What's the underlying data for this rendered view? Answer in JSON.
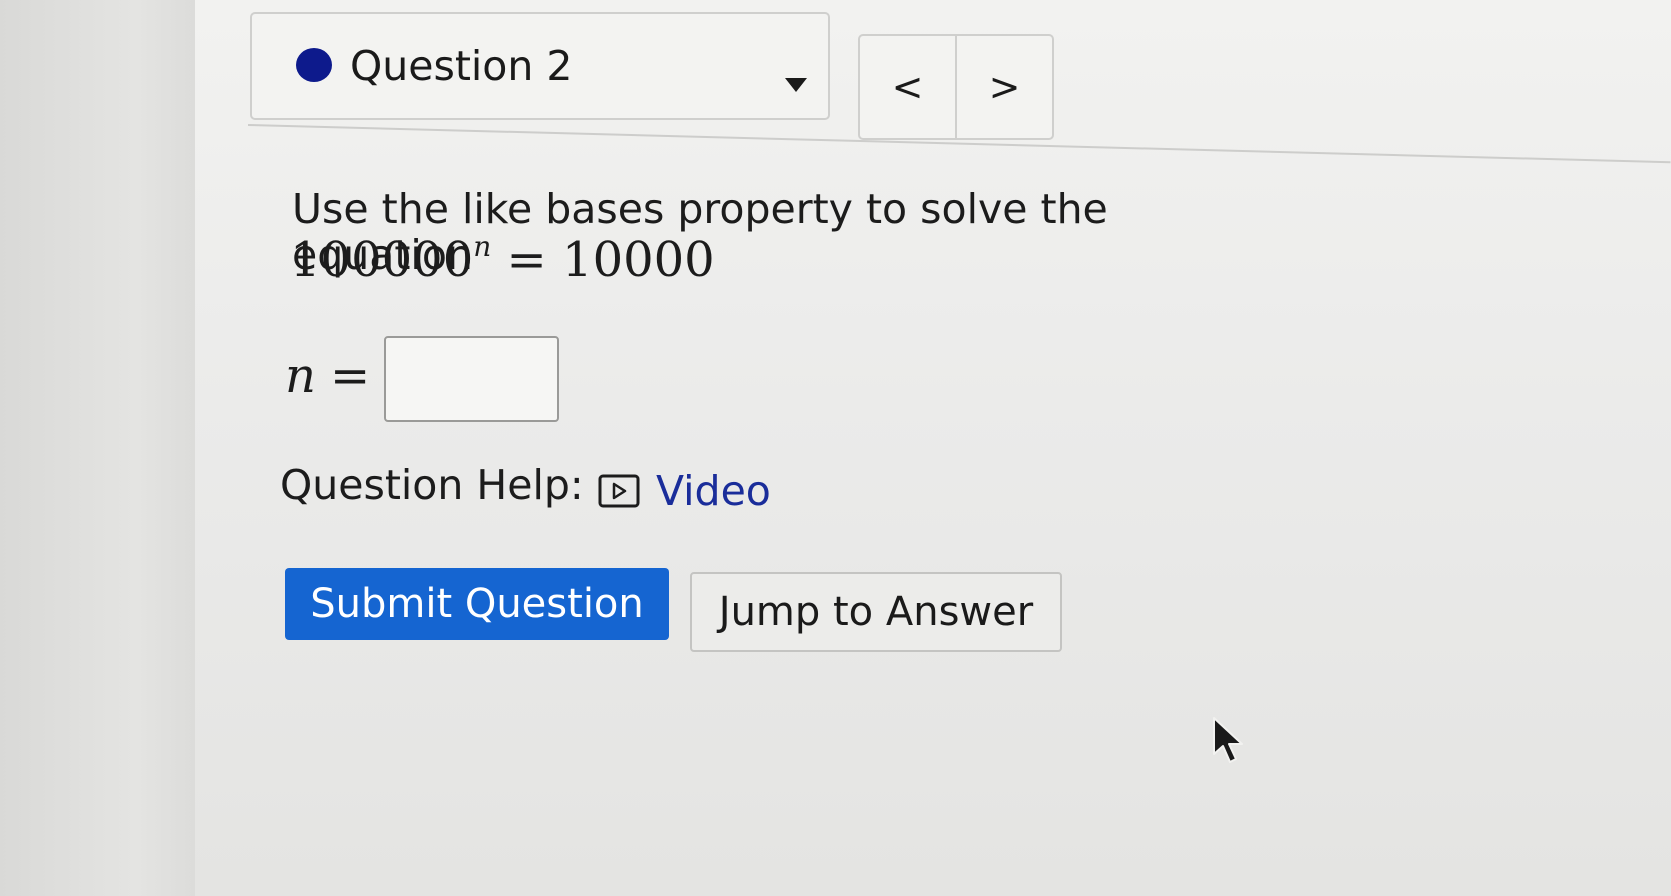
{
  "header": {
    "question_label": "Question 2",
    "prev_label": "<",
    "next_label": ">",
    "status_color": "#0d1a8c"
  },
  "question": {
    "prompt": "Use the like bases property to solve the equation",
    "equation_base": "100000",
    "equation_exponent": "n",
    "equation_rhs": "= 10000",
    "answer_variable": "n",
    "answer_equals": "=",
    "answer_value": ""
  },
  "help": {
    "label": "Question Help:",
    "video_label": "Video",
    "video_icon": "play-box-icon"
  },
  "actions": {
    "submit_label": "Submit Question",
    "jump_label": "Jump to Answer",
    "submit_color": "#1565d1"
  }
}
